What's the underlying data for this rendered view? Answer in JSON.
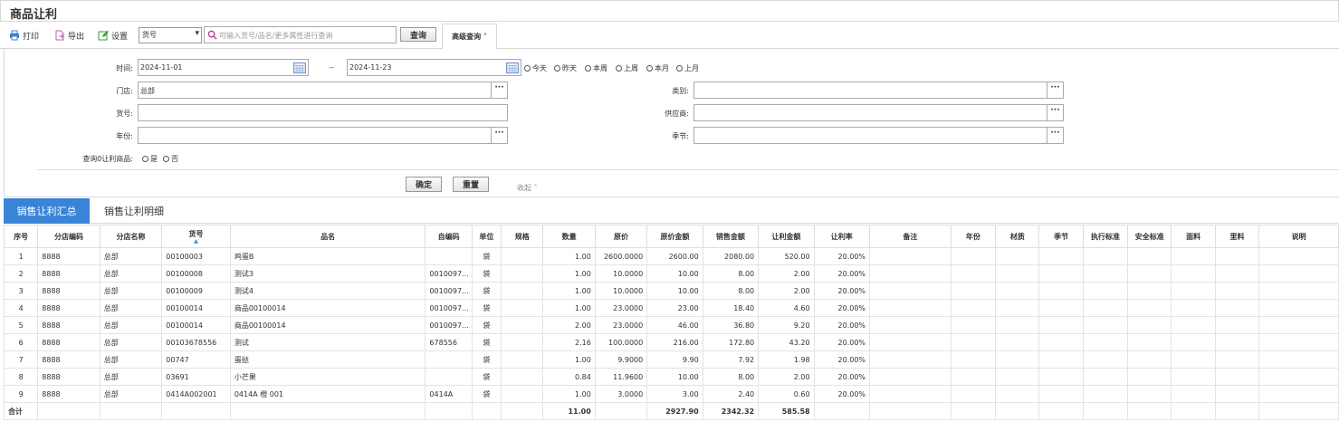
{
  "window": {
    "title": "商品让利"
  },
  "toolbar": {
    "print_label": "打印",
    "export_label": "导出",
    "settings_label": "设置",
    "field_select_value": "货号",
    "search_placeholder": "可输入货号/品名/更多属性进行查询",
    "query_label": "查询",
    "advanced_label": "高级查询 ˄"
  },
  "filters": {
    "time_label": "时间:",
    "date_from": "2024-11-01",
    "date_sep": "--",
    "date_to": "2024-11-23",
    "quick_dates": [
      "今天",
      "昨天",
      "本周",
      "上周",
      "本月",
      "上月"
    ],
    "store_label": "门店:",
    "store_value": "总部",
    "category_label": "类别:",
    "category_value": "",
    "itemno_label": "货号:",
    "itemno_value": "",
    "supplier_label": "供应商:",
    "supplier_value": "",
    "year_label": "年份:",
    "year_value": "",
    "season_label": "季节:",
    "season_value": "",
    "zero_label": "查询0让利商品:",
    "zero_yes": "是",
    "zero_no": "否",
    "confirm_label": "确定",
    "reset_label": "重置",
    "collapse_label": "收起 ˄"
  },
  "tabs": [
    "销售让利汇总",
    "销售让利明细"
  ],
  "table": {
    "columns": [
      "序号",
      "分店编码",
      "分店名称",
      "货号",
      "品名",
      "自编码",
      "单位",
      "规格",
      "数量",
      "原价",
      "原价金额",
      "销售金额",
      "让利金额",
      "让利率",
      "备注",
      "年份",
      "材质",
      "季节",
      "执行标准",
      "安全标准",
      "面料",
      "里料",
      "说明"
    ],
    "rows": [
      [
        "1",
        "8888",
        "总部",
        "00100003",
        "鸡蛋B",
        "",
        "袋",
        "",
        "1.00",
        "2600.0000",
        "2600.00",
        "2080.00",
        "520.00",
        "20.00%"
      ],
      [
        "2",
        "8888",
        "总部",
        "00100008",
        "测试3",
        "0010097...",
        "袋",
        "",
        "1.00",
        "10.0000",
        "10.00",
        "8.00",
        "2.00",
        "20.00%"
      ],
      [
        "3",
        "8888",
        "总部",
        "00100009",
        "测试4",
        "0010097...",
        "袋",
        "",
        "1.00",
        "10.0000",
        "10.00",
        "8.00",
        "2.00",
        "20.00%"
      ],
      [
        "4",
        "8888",
        "总部",
        "00100014",
        "商品00100014",
        "0010097...",
        "袋",
        "",
        "1.00",
        "23.0000",
        "23.00",
        "18.40",
        "4.60",
        "20.00%"
      ],
      [
        "5",
        "8888",
        "总部",
        "00100014",
        "商品00100014",
        "0010097...",
        "袋",
        "",
        "2.00",
        "23.0000",
        "46.00",
        "36.80",
        "9.20",
        "20.00%"
      ],
      [
        "6",
        "8888",
        "总部",
        "00103678556",
        "测试",
        "678556",
        "袋",
        "",
        "2.16",
        "100.0000",
        "216.00",
        "172.80",
        "43.20",
        "20.00%"
      ],
      [
        "7",
        "8888",
        "总部",
        "00747",
        "蛋挞",
        "",
        "袋",
        "",
        "1.00",
        "9.9000",
        "9.90",
        "7.92",
        "1.98",
        "20.00%"
      ],
      [
        "8",
        "8888",
        "总部",
        "03691",
        "小芒果",
        "",
        "袋",
        "",
        "0.84",
        "11.9600",
        "10.00",
        "8.00",
        "2.00",
        "20.00%"
      ],
      [
        "9",
        "8888",
        "总部",
        "0414A002001",
        "0414A 橙 001",
        "0414A",
        "袋",
        "",
        "1.00",
        "3.0000",
        "3.00",
        "2.40",
        "0.60",
        "20.00%"
      ]
    ],
    "total": {
      "label": "合计",
      "qty": "11.00",
      "orig_amount": "2927.90",
      "sales_amount": "2342.32",
      "discount_amount": "585.58"
    }
  }
}
